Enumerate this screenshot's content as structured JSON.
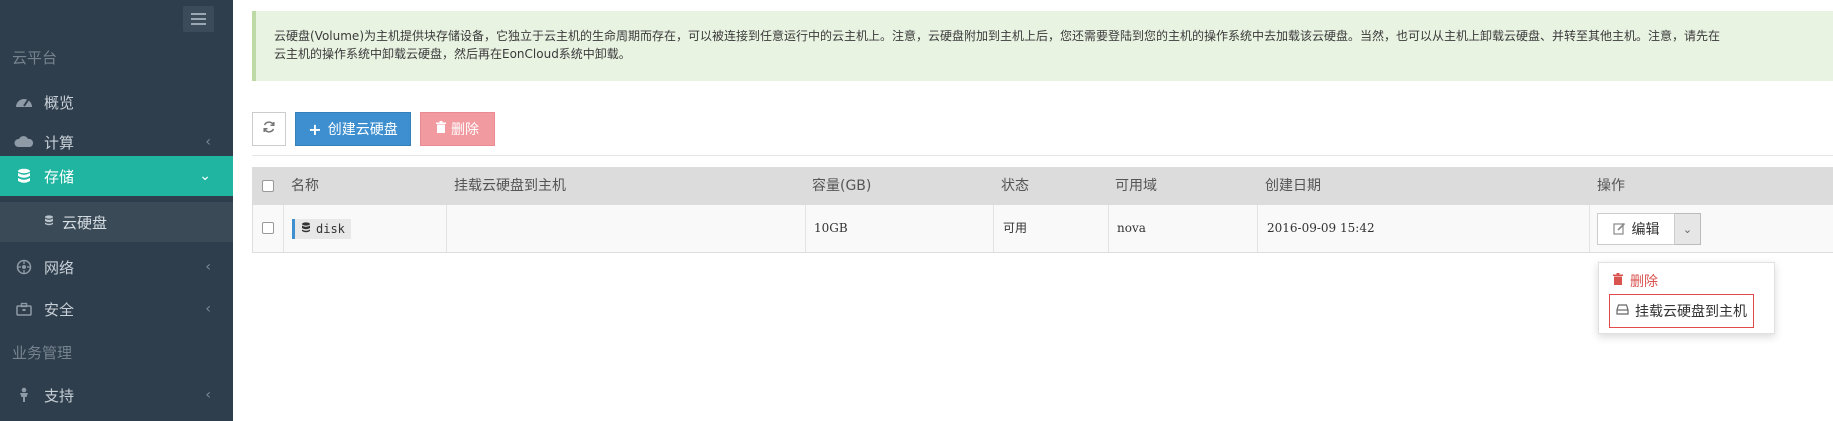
{
  "sidebar": {
    "section_cloud": "云平台",
    "section_business": "业务管理",
    "items": [
      {
        "label": "概览",
        "icon": "dashboard-icon"
      },
      {
        "label": "计算",
        "icon": "cloud-icon"
      },
      {
        "label": "存储",
        "icon": "database-icon"
      },
      {
        "label": "网络",
        "icon": "network-icon"
      },
      {
        "label": "安全",
        "icon": "briefcase-icon"
      },
      {
        "label": "支持",
        "icon": "support-icon"
      }
    ],
    "subitem": {
      "label": "云硬盘",
      "icon": "database-icon"
    },
    "active_color": "#1fb5a0",
    "bg_color": "#2f3e4c"
  },
  "notice": {
    "line1": "云硬盘(Volume)为主机提供块存储设备，它独立于云主机的生命周期而存在，可以被连接到任意运行中的云主机上。注意，云硬盘附加到主机上后，您还需要登陆到您的主机的操作系统中去加载该云硬盘。当然，也可以从主机上卸载云硬盘、并转至其他主机。注意，请先在",
    "line2": "云主机的操作系统中卸载云硬盘，然后再在EonCloud系统中卸载。"
  },
  "toolbar": {
    "create_label": "创建云硬盘",
    "delete_label": "删除",
    "create_color": "#3d8fcf",
    "delete_color": "#f19aa0"
  },
  "table": {
    "headers": [
      "名称",
      "挂载云硬盘到主机",
      "容量(GB)",
      "状态",
      "可用域",
      "创建日期",
      "操作"
    ],
    "rows": [
      {
        "name": "disk",
        "attached_host": "",
        "capacity": "10GB",
        "status": "可用",
        "zone": "nova",
        "created": "2016-09-09 15:42"
      }
    ]
  },
  "actions": {
    "edit_label": "编辑",
    "menu": {
      "delete_label": "删除",
      "attach_label": "挂载云硬盘到主机"
    }
  }
}
